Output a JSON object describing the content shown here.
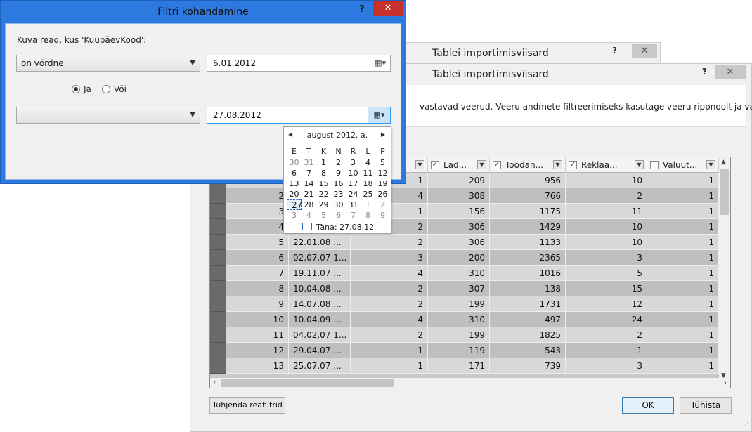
{
  "wizard_back": {
    "title": "Tablei importimisviisard",
    "help": "?",
    "close": "✕"
  },
  "wizard": {
    "title": "Tablei importimisviisard",
    "help": "?",
    "close": "✕",
    "description": "vastavad veerud. Veeru andmete filtreerimiseks kasutage veeru rippnoolt ja valige",
    "clear_filters_button": "Tühjenda reafiltrid",
    "ok_button": "OK",
    "cancel_button": "Tühista",
    "grid": {
      "headers": [
        {
          "label": "",
          "checked": true
        },
        {
          "label": "Lad...",
          "checked": true
        },
        {
          "label": "Toodan...",
          "checked": true
        },
        {
          "label": "Reklaa...",
          "checked": true
        },
        {
          "label": "Valuut...",
          "checked": false
        }
      ],
      "rows": [
        [
          "",
          "",
          "1",
          "209",
          "956",
          "10",
          "1"
        ],
        [
          "2",
          "",
          "4",
          "308",
          "766",
          "2",
          "1"
        ],
        [
          "3",
          "",
          "1",
          "156",
          "1175",
          "11",
          "1"
        ],
        [
          "4",
          "",
          "2",
          "306",
          "1429",
          "10",
          "1"
        ],
        [
          "5",
          "22.01.08 ...",
          "2",
          "306",
          "1133",
          "10",
          "1"
        ],
        [
          "6",
          "02.07.07 1...",
          "3",
          "200",
          "2365",
          "3",
          "1"
        ],
        [
          "7",
          "19.11.07 ...",
          "4",
          "310",
          "1016",
          "5",
          "1"
        ],
        [
          "8",
          "10.04.08 ...",
          "2",
          "307",
          "138",
          "15",
          "1"
        ],
        [
          "9",
          "14.07.08 ...",
          "2",
          "199",
          "1731",
          "12",
          "1"
        ],
        [
          "10",
          "10.04.09 ...",
          "4",
          "310",
          "497",
          "24",
          "1"
        ],
        [
          "11",
          "04.02.07 1...",
          "2",
          "199",
          "1825",
          "2",
          "1"
        ],
        [
          "12",
          "29.04.07 ...",
          "1",
          "119",
          "543",
          "1",
          "1"
        ],
        [
          "13",
          "25.07.07 ...",
          "1",
          "171",
          "739",
          "3",
          "1"
        ]
      ]
    }
  },
  "filter_dialog": {
    "title": "Filtri kohandamine",
    "help": "?",
    "close": "✕",
    "prompt": "Kuva read, kus 'KuupäevKood':",
    "operator1": "on võrdne",
    "value1": "6.01.2012",
    "logic_and": "Ja",
    "logic_or": "Või",
    "logic_selected": "and",
    "operator2": "",
    "value2": "27.08.2012"
  },
  "calendar": {
    "month_label": "august 2012. a.",
    "weekdays": [
      "E",
      "T",
      "K",
      "N",
      "R",
      "L",
      "P"
    ],
    "weeks": [
      [
        "30",
        "31",
        "1",
        "2",
        "3",
        "4",
        "5"
      ],
      [
        "6",
        "7",
        "8",
        "9",
        "10",
        "11",
        "12"
      ],
      [
        "13",
        "14",
        "15",
        "16",
        "17",
        "18",
        "19"
      ],
      [
        "20",
        "21",
        "22",
        "23",
        "24",
        "25",
        "26"
      ],
      [
        "27",
        "28",
        "29",
        "30",
        "31",
        "1",
        "2"
      ],
      [
        "3",
        "4",
        "5",
        "6",
        "7",
        "8",
        "9"
      ]
    ],
    "selected_day": "27",
    "today_label": "Täna: 27.08.12"
  }
}
